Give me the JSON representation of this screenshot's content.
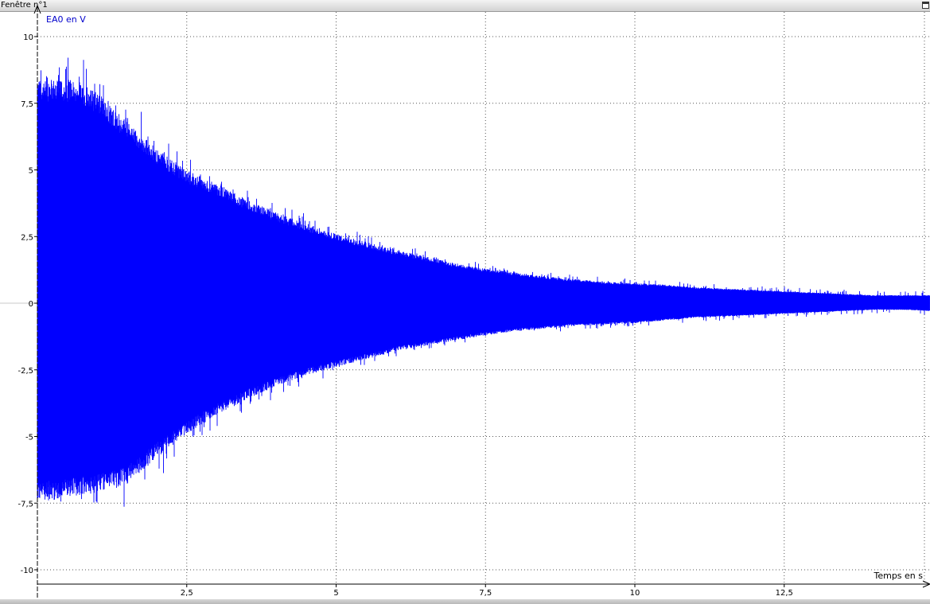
{
  "window": {
    "title": "Fenêtre n°1"
  },
  "chart_data": {
    "type": "line",
    "title": "",
    "xlabel": "Temps en s",
    "ylabel": "EA0 en V",
    "xlim": [
      0,
      15
    ],
    "ylim": [
      -10.5,
      10.5
    ],
    "grid": true,
    "x_ticks": [
      {
        "value": 2.5,
        "label": "2,5"
      },
      {
        "value": 5,
        "label": "5"
      },
      {
        "value": 7.5,
        "label": "7,5"
      },
      {
        "value": 10,
        "label": "10"
      },
      {
        "value": 12.5,
        "label": "12,5"
      }
    ],
    "y_ticks": [
      {
        "value": 10,
        "label": "10"
      },
      {
        "value": 7.5,
        "label": "7,5"
      },
      {
        "value": 5,
        "label": "5"
      },
      {
        "value": 2.5,
        "label": "2,5"
      },
      {
        "value": 0,
        "label": "0"
      },
      {
        "value": -2.5,
        "label": "-2,5"
      },
      {
        "value": -5,
        "label": "-5"
      },
      {
        "value": -7.5,
        "label": "-7,5"
      },
      {
        "value": -10,
        "label": "-10"
      }
    ],
    "series": [
      {
        "color": "#0000ff",
        "description": "damped oscillation signal, envelope points (t, max, min)",
        "envelope_t": [
          0,
          0.25,
          0.5,
          0.75,
          1.0,
          1.25,
          1.5,
          2.0,
          2.5,
          3.0,
          3.5,
          4.0,
          4.5,
          5.0,
          5.5,
          6.0,
          6.5,
          7.0,
          7.5,
          8.0,
          8.5,
          9.0,
          9.5,
          10.0,
          10.5,
          11.0,
          11.5,
          12.0,
          12.5,
          13.0,
          13.5,
          14.0,
          14.5,
          15.0
        ],
        "envelope_max": [
          8.4,
          8.4,
          8.4,
          8.3,
          7.9,
          7.4,
          6.8,
          5.8,
          5.0,
          4.5,
          3.9,
          3.4,
          3.0,
          2.6,
          2.3,
          2.0,
          1.75,
          1.5,
          1.3,
          1.15,
          1.0,
          0.9,
          0.8,
          0.75,
          0.7,
          0.6,
          0.55,
          0.5,
          0.45,
          0.4,
          0.35,
          0.3,
          0.3,
          0.3
        ],
        "envelope_min": [
          -7.4,
          -7.4,
          -7.3,
          -7.2,
          -7.1,
          -7.0,
          -6.8,
          -5.8,
          -4.9,
          -4.2,
          -3.6,
          -3.1,
          -2.7,
          -2.4,
          -2.1,
          -1.8,
          -1.6,
          -1.4,
          -1.2,
          -1.05,
          -0.95,
          -0.85,
          -0.8,
          -0.75,
          -0.65,
          -0.55,
          -0.5,
          -0.45,
          -0.4,
          -0.35,
          -0.3,
          -0.25,
          -0.25,
          -0.3
        ]
      }
    ]
  }
}
